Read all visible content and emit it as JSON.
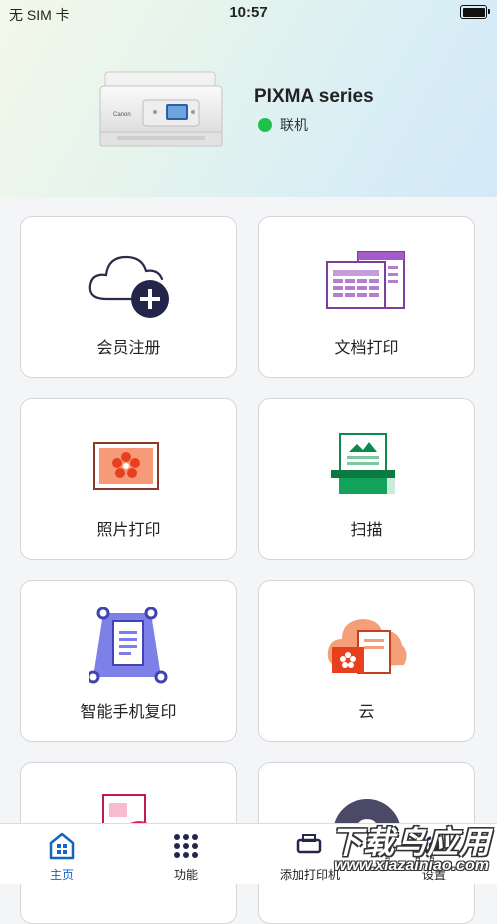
{
  "status_bar": {
    "carrier": "无 SIM 卡",
    "time": "10:57"
  },
  "printer": {
    "name": "PIXMA series",
    "status": "联机",
    "status_color": "#1ec24a"
  },
  "menu": {
    "items": [
      {
        "label": "会员注册",
        "icon": "cloud-plus-icon"
      },
      {
        "label": "文档打印",
        "icon": "document-print-icon"
      },
      {
        "label": "照片打印",
        "icon": "photo-print-icon"
      },
      {
        "label": "扫描",
        "icon": "scan-icon"
      },
      {
        "label": "智能手机复印",
        "icon": "smartphone-copy-icon"
      },
      {
        "label": "云",
        "icon": "cloud-print-icon"
      },
      {
        "label": "",
        "icon": "photo-layout-icon"
      },
      {
        "label": "",
        "icon": "help-icon"
      }
    ]
  },
  "tabbar": {
    "tabs": [
      {
        "label": "主页",
        "icon": "home-icon",
        "active": true
      },
      {
        "label": "功能",
        "icon": "grid-icon",
        "active": false
      },
      {
        "label": "添加打印机",
        "icon": "add-printer-icon",
        "active": false
      },
      {
        "label": "设置",
        "icon": "settings-icon",
        "active": false
      }
    ],
    "active_color": "#1565c0"
  },
  "watermark": {
    "title": "下载鸟应用",
    "url": "www.xiazainiao.com"
  }
}
